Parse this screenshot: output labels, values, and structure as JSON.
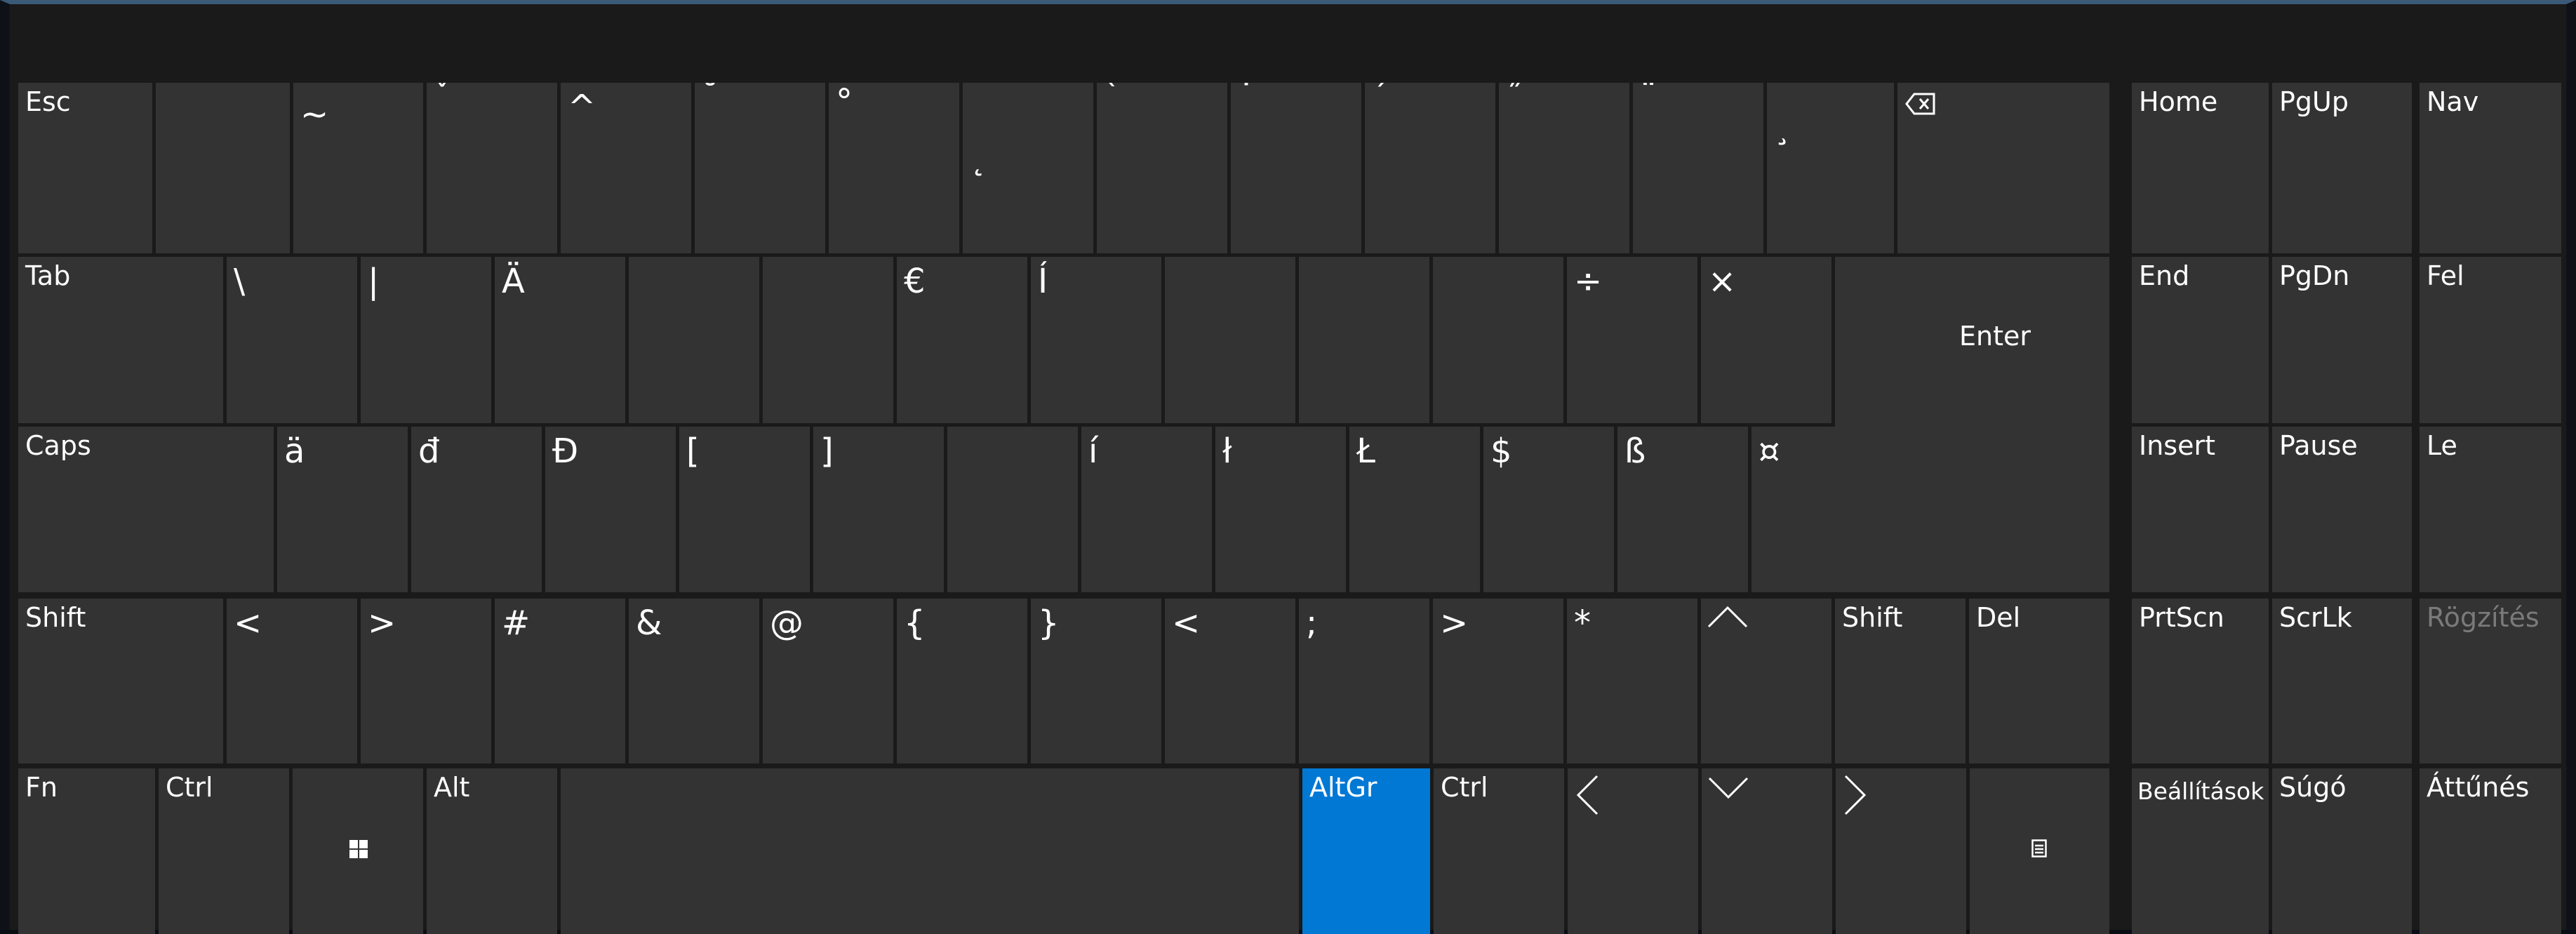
{
  "keyboard": {
    "row1": {
      "esc": "Esc",
      "k1": "",
      "k2": "~",
      "k3": "ˇ",
      "k4": "^",
      "k5": "˘",
      "k6": "°",
      "k7": "˛",
      "k8": "`",
      "k9": "˙",
      "k10": "´",
      "k11": "˝",
      "k12": "¨",
      "k13": "¸",
      "backspace_icon": "backspace-icon"
    },
    "row2": {
      "tab": "Tab",
      "q": "\\",
      "w": "|",
      "e": "Ä",
      "r": "",
      "t": "",
      "z": "€",
      "u": "Í",
      "i": "",
      "o": "",
      "p": "÷",
      "bracket": "×",
      "enter": "Enter"
    },
    "row3": {
      "caps": "Caps",
      "a": "ä",
      "s": "đ",
      "d": "Đ",
      "f": "[",
      "g": "]",
      "h": "",
      "j": "í",
      "k": "ł",
      "l": "Ł",
      "semi": "$",
      "quote": "ß",
      "hash": "¤"
    },
    "row4": {
      "shift_left": "Shift",
      "lt": "<",
      "y": ">",
      "x": "#",
      "c": "&",
      "v": "@",
      "b": "{",
      "n": "}",
      "m": "<",
      "comma": ";",
      "period": ">",
      "minus": "*",
      "up_icon": "up-arrow-icon",
      "shift_right": "Shift",
      "del": "Del"
    },
    "row5": {
      "fn": "Fn",
      "ctrl_left": "Ctrl",
      "win_icon": "windows-icon",
      "alt": "Alt",
      "space": "",
      "altgr": "AltGr",
      "ctrl_right": "Ctrl",
      "left_icon": "left-arrow-icon",
      "down_icon": "down-arrow-icon",
      "right_icon": "right-arrow-icon",
      "menu_icon": "context-menu-icon"
    },
    "nav": {
      "home": "Home",
      "pgup": "PgUp",
      "nav": "Nav",
      "end": "End",
      "pgdn": "PgDn",
      "fel": "Fel",
      "insert": "Insert",
      "pause": "Pause",
      "le": "Le",
      "prtscn": "PrtScn",
      "scrlk": "ScrLk",
      "rogzites": "Rögzítés",
      "beallitasok": "Beállítások",
      "sugo": "Súgó",
      "attunes": "Áttűnés"
    }
  },
  "colors": {
    "key": "#333333",
    "key_active": "#0078d4",
    "background": "#1a1a1a",
    "text": "#ffffff",
    "text_disabled": "#7a7a7a"
  }
}
